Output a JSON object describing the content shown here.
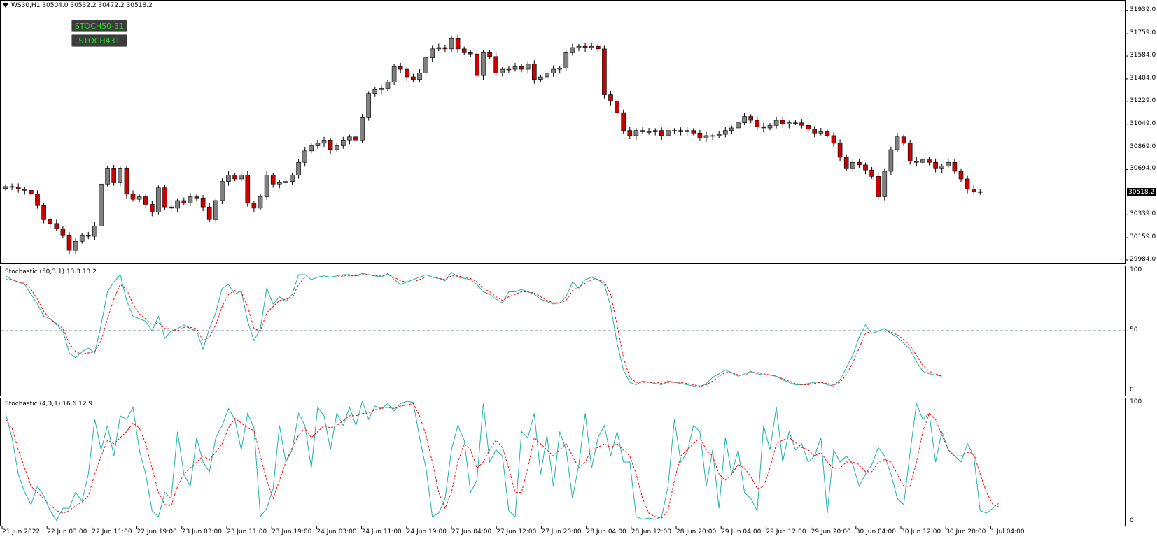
{
  "header": {
    "symbol_line": "WS30,H1  30504.0 30532.2 30472.2 30518.2",
    "dropdown_icon": "triangle-down-icon"
  },
  "buttons": [
    {
      "label": "STOCH50-31"
    },
    {
      "label": "STOCH431"
    }
  ],
  "price_axis": {
    "ticks": [
      "31939.0",
      "31759.0",
      "31584.0",
      "31404.0",
      "31229.0",
      "31049.0",
      "30869.0",
      "30694.0",
      "30339.0",
      "30159.0",
      "29984.0"
    ],
    "current_price": "30518.2"
  },
  "stoch1": {
    "label": "Stochastic (50,3,1) 13.3 13.2",
    "ticks": [
      "100",
      "50",
      "0"
    ]
  },
  "stoch2": {
    "label": "Stochastic (4,3,1) 16.6 12.9",
    "ticks": [
      "100",
      "0"
    ]
  },
  "time_axis": [
    "21 Jun 2022",
    "22 Jun 03:00",
    "22 Jun 11:00",
    "22 Jun 19:00",
    "23 Jun 03:00",
    "23 Jun 11:00",
    "23 Jun 19:00",
    "24 Jun 03:00",
    "24 Jun 11:00",
    "24 Jun 19:00",
    "27 Jun 04:00",
    "27 Jun 12:00",
    "27 Jun 20:00",
    "28 Jun 04:00",
    "28 Jun 12:00",
    "28 Jun 20:00",
    "29 Jun 04:00",
    "29 Jun 12:00",
    "29 Jun 20:00",
    "30 Jun 04:00",
    "30 Jun 12:00",
    "30 Jun 20:00",
    "1 Jul 04:00"
  ],
  "colors": {
    "bull": "#808080",
    "bear": "#cc0000",
    "main_line": "#20b2aa",
    "signal_line": "#ff0000",
    "grid": "#777777"
  },
  "chart_data": [
    {
      "type": "candlestick",
      "title": "WS30,H1",
      "ylim": [
        29984,
        31990
      ],
      "closes": [
        30560,
        30555,
        30540,
        30530,
        30500,
        30410,
        30300,
        30270,
        30230,
        30180,
        30060,
        30130,
        30180,
        30170,
        30250,
        30580,
        30700,
        30590,
        30700,
        30500,
        30460,
        30480,
        30420,
        30360,
        30550,
        30400,
        30390,
        30450,
        30430,
        30480,
        30470,
        30400,
        30300,
        30450,
        30600,
        30650,
        30620,
        30650,
        30430,
        30390,
        30480,
        30650,
        30580,
        30590,
        30600,
        30650,
        30750,
        30840,
        30880,
        30900,
        30920,
        30850,
        30880,
        30920,
        30950,
        30920,
        31100,
        31290,
        31320,
        31330,
        31380,
        31500,
        31480,
        31420,
        31400,
        31450,
        31570,
        31640,
        31650,
        31640,
        31720,
        31640,
        31610,
        31600,
        31430,
        31610,
        31580,
        31450,
        31480,
        31480,
        31500,
        31480,
        31520,
        31400,
        31420,
        31450,
        31480,
        31490,
        31610,
        31650,
        31660,
        31650,
        31660,
        31640,
        31280,
        31230,
        31140,
        31000,
        30960,
        31000,
        30990,
        30990,
        31000,
        30960,
        31000,
        31000,
        30990,
        31000,
        30980,
        30940,
        30960,
        30960,
        30970,
        31000,
        31020,
        31060,
        31110,
        31080,
        31030,
        31020,
        31040,
        31080,
        31050,
        31060,
        31060,
        31040,
        31010,
        30980,
        30990,
        30960,
        30900,
        30790,
        30700,
        30750,
        30730,
        30690,
        30640,
        30480,
        30680,
        30850,
        30950,
        30900,
        30760,
        30750,
        30770,
        30750,
        30700,
        30720,
        30750,
        30680,
        30620,
        30540,
        30520,
        30518
      ]
    },
    {
      "type": "line",
      "name": "Stochastic (50,3,1)",
      "ylim": [
        0,
        100
      ],
      "main": [
        95,
        92,
        90,
        88,
        80,
        72,
        62,
        60,
        55,
        50,
        32,
        28,
        33,
        36,
        32,
        55,
        82,
        90,
        96,
        75,
        62,
        60,
        58,
        50,
        62,
        44,
        50,
        52,
        55,
        52,
        50,
        35,
        52,
        65,
        85,
        88,
        80,
        83,
        58,
        42,
        52,
        85,
        72,
        78,
        74,
        80,
        96,
        96,
        92,
        94,
        95,
        94,
        95,
        96,
        96,
        95,
        97,
        96,
        95,
        94,
        97,
        92,
        88,
        90,
        92,
        94,
        96,
        94,
        93,
        91,
        98,
        94,
        93,
        92,
        88,
        82,
        80,
        76,
        73,
        82,
        82,
        84,
        82,
        80,
        76,
        74,
        72,
        73,
        78,
        90,
        85,
        92,
        94,
        92,
        88,
        70,
        40,
        18,
        8,
        6,
        9,
        8,
        7,
        6,
        9,
        8,
        7,
        6,
        5,
        4,
        7,
        12,
        15,
        18,
        16,
        13,
        15,
        17,
        15,
        14,
        14,
        13,
        10,
        8,
        6,
        6,
        7,
        8,
        8,
        6,
        5,
        10,
        20,
        30,
        45,
        55,
        48,
        50,
        52,
        48,
        45,
        40,
        35,
        25,
        17,
        15,
        14,
        13
      ],
      "signal": [
        92,
        92,
        90,
        89,
        84,
        76,
        66,
        60,
        56,
        52,
        40,
        33,
        31,
        32,
        33,
        42,
        60,
        76,
        88,
        84,
        72,
        64,
        60,
        55,
        57,
        52,
        52,
        50,
        53,
        53,
        52,
        42,
        45,
        55,
        70,
        80,
        83,
        82,
        70,
        52,
        50,
        65,
        70,
        75,
        76,
        77,
        88,
        94,
        94,
        94,
        94,
        94,
        94,
        95,
        95,
        95,
        96,
        96,
        95,
        95,
        96,
        94,
        91,
        90,
        90,
        92,
        94,
        94,
        93,
        92,
        95,
        95,
        94,
        93,
        90,
        85,
        82,
        78,
        75,
        78,
        80,
        82,
        82,
        81,
        78,
        75,
        73,
        73,
        75,
        83,
        86,
        89,
        92,
        92,
        90,
        80,
        55,
        28,
        12,
        8,
        8,
        8,
        8,
        7,
        8,
        8,
        8,
        7,
        6,
        5,
        6,
        9,
        13,
        16,
        16,
        14,
        14,
        16,
        16,
        15,
        14,
        13,
        11,
        9,
        7,
        6,
        6,
        7,
        8,
        7,
        6,
        8,
        14,
        24,
        36,
        48,
        50,
        50,
        50,
        49,
        47,
        43,
        38,
        30,
        22,
        17,
        15,
        13
      ]
    },
    {
      "type": "line",
      "name": "Stochastic (4,3,1)",
      "ylim": [
        0,
        100
      ],
      "main": [
        90,
        70,
        40,
        25,
        15,
        30,
        22,
        10,
        2,
        12,
        12,
        25,
        18,
        40,
        85,
        60,
        80,
        55,
        88,
        85,
        95,
        60,
        40,
        10,
        5,
        25,
        20,
        75,
        40,
        30,
        70,
        50,
        42,
        70,
        80,
        94,
        85,
        60,
        90,
        78,
        5,
        12,
        28,
        80,
        50,
        60,
        90,
        80,
        45,
        95,
        88,
        60,
        90,
        80,
        95,
        80,
        100,
        85,
        96,
        94,
        98,
        92,
        98,
        100,
        99,
        70,
        45,
        5,
        8,
        20,
        60,
        80,
        68,
        25,
        35,
        98,
        50,
        60,
        55,
        10,
        5,
        75,
        70,
        90,
        40,
        72,
        30,
        75,
        60,
        20,
        48,
        90,
        45,
        70,
        80,
        55,
        75,
        50,
        50,
        5,
        3,
        4,
        3,
        5,
        30,
        85,
        50,
        58,
        80,
        75,
        30,
        60,
        12,
        70,
        40,
        60,
        25,
        20,
        10,
        80,
        60,
        95,
        50,
        75,
        60,
        65,
        50,
        55,
        70,
        8,
        60,
        50,
        55,
        48,
        30,
        40,
        48,
        62,
        55,
        40,
        20,
        15,
        58,
        98,
        85,
        90,
        50,
        75,
        60,
        55,
        50,
        65,
        55,
        10,
        8,
        12,
        16.6
      ],
      "signal": [
        85,
        78,
        60,
        45,
        30,
        25,
        20,
        15,
        10,
        8,
        10,
        14,
        17,
        22,
        40,
        55,
        68,
        65,
        70,
        75,
        82,
        78,
        65,
        45,
        25,
        15,
        14,
        30,
        40,
        45,
        50,
        55,
        52,
        58,
        65,
        78,
        86,
        82,
        78,
        76,
        55,
        35,
        20,
        35,
        50,
        62,
        72,
        78,
        70,
        75,
        80,
        78,
        80,
        84,
        88,
        88,
        90,
        90,
        93,
        94,
        95,
        94,
        96,
        97,
        98,
        88,
        72,
        50,
        25,
        12,
        25,
        50,
        65,
        60,
        45,
        50,
        60,
        68,
        62,
        45,
        25,
        25,
        45,
        70,
        65,
        60,
        55,
        60,
        65,
        55,
        45,
        50,
        60,
        62,
        65,
        62,
        65,
        60,
        55,
        40,
        20,
        8,
        5,
        4,
        10,
        35,
        55,
        60,
        65,
        70,
        60,
        55,
        40,
        35,
        40,
        48,
        45,
        38,
        28,
        30,
        45,
        65,
        68,
        70,
        66,
        62,
        60,
        55,
        58,
        50,
        45,
        45,
        50,
        50,
        48,
        42,
        42,
        50,
        52,
        50,
        40,
        30,
        30,
        50,
        75,
        90,
        85,
        72,
        60,
        55,
        55,
        58,
        57,
        40,
        25,
        15,
        12.9
      ]
    }
  ]
}
